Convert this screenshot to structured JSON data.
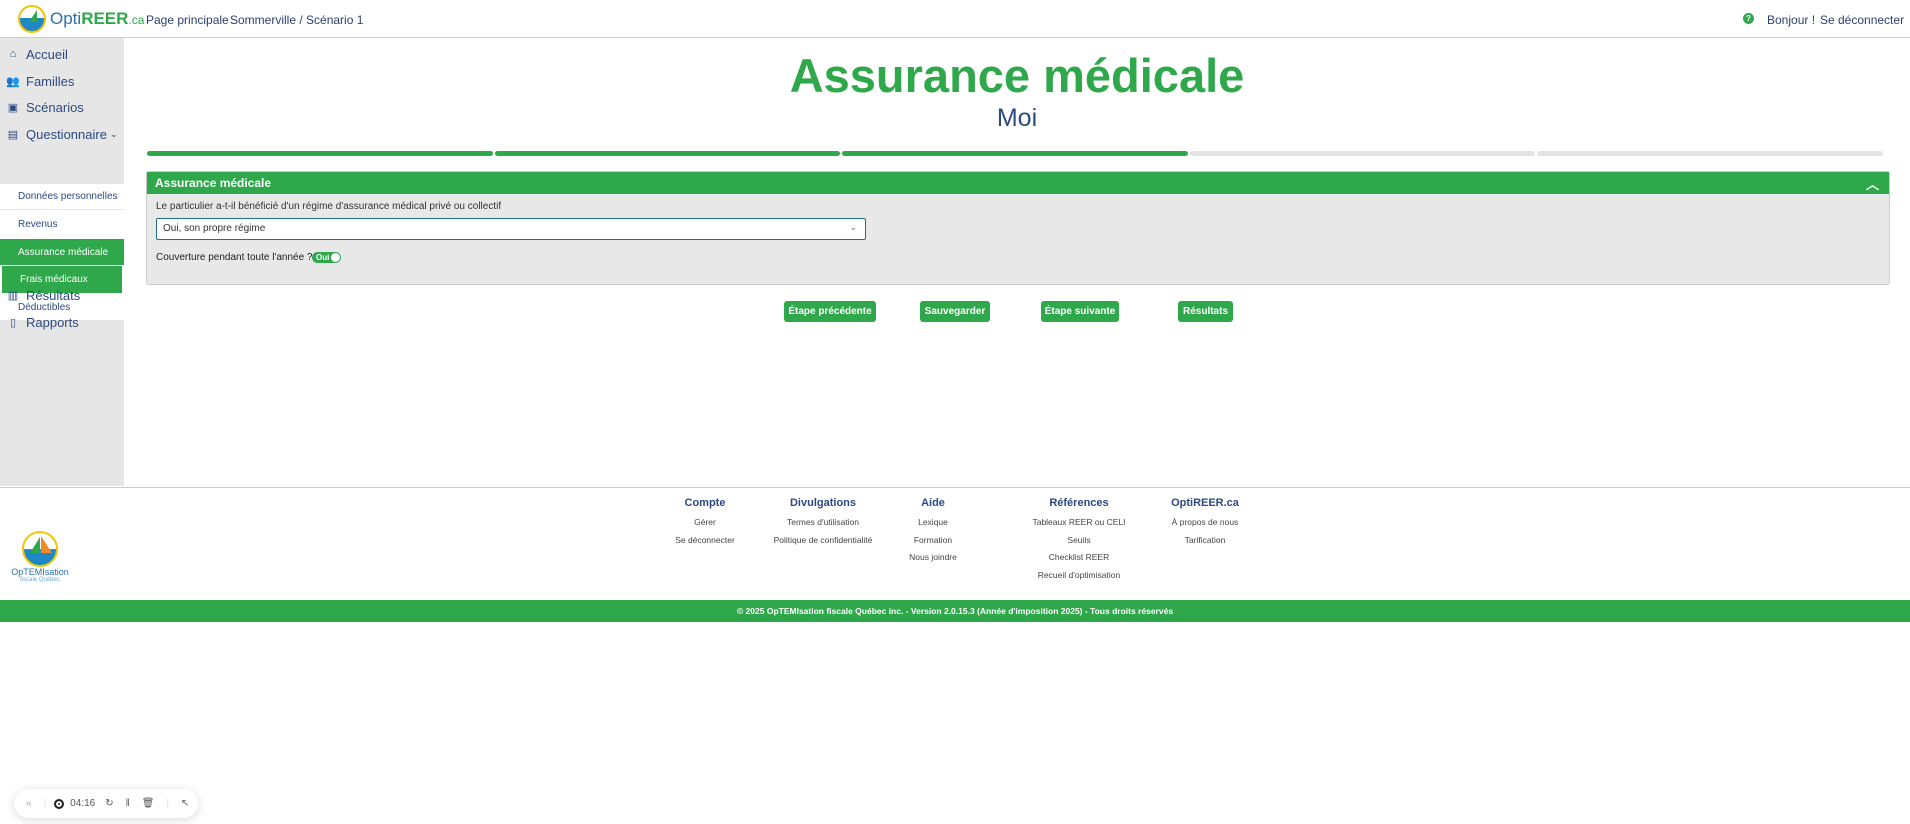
{
  "header": {
    "brand_prefix": "Opti",
    "brand_mid": "REER",
    "brand_suffix": ".ca",
    "nav": [
      "Page principale",
      "Sommerville / Scénario 1"
    ],
    "help_icon": "?",
    "greeting": "Bonjour !",
    "logout": "Se déconnecter"
  },
  "sidebar": {
    "items": [
      {
        "label": "Accueil",
        "icon": "home-icon"
      },
      {
        "label": "Familles",
        "icon": "people-icon"
      },
      {
        "label": "Scénarios",
        "icon": "chart-icon"
      },
      {
        "label": "Questionnaire",
        "icon": "document-icon"
      }
    ],
    "subitems": [
      "Données personnelles",
      "Revenus",
      "Assurance médicale",
      "Frais médicaux",
      "Déductibles"
    ],
    "bottom": [
      {
        "label": "Résultats",
        "icon": "bar-chart-icon"
      },
      {
        "label": "Rapports",
        "icon": "report-icon"
      }
    ]
  },
  "main": {
    "title": "Assurance médicale",
    "subtitle": "Moi",
    "progress": {
      "steps": 5,
      "completed": 3
    },
    "panel": {
      "title": "Assurance médicale",
      "question": "Le particulier a-t-il bénéficié d'un régime d'assurance médical privé ou collectif",
      "selected": "Oui, son propre régime",
      "coverage_label": "Couverture pendant toute l'année ?",
      "toggle_label": "Oui"
    },
    "buttons": [
      "Étape précédente",
      "Sauvegarder",
      "Étape suivante",
      "Résultats"
    ]
  },
  "footer": {
    "columns": [
      {
        "title": "Compte",
        "links": [
          "Gérer",
          "Se déconnecter"
        ]
      },
      {
        "title": "Divulgations",
        "links": [
          "Termes d'utilisation",
          "Politique de confidentialité"
        ]
      },
      {
        "title": "Aide",
        "links": [
          "Lexique",
          "Formation",
          "Nous joindre"
        ]
      },
      {
        "title": "Références",
        "links": [
          "Tableaux REER ou CELI",
          "Seuils",
          "Checklist REER",
          "Recueil d'optimisation"
        ]
      },
      {
        "title": "OptiREER.ca",
        "links": [
          "À propos de nous",
          "Tarification"
        ]
      }
    ],
    "logo_line1": "OpTEMIsation",
    "logo_line2": "fiscale Québec",
    "copyright": "© 2025 OpTEMIsation fiscale Québec inc. - Version 2.0.15.3 (Année d'imposition 2025) - Tous droits réservés"
  },
  "recorder": {
    "time": "04:16"
  },
  "colors": {
    "accent": "#2ea84a",
    "navy": "#2c4a80"
  }
}
